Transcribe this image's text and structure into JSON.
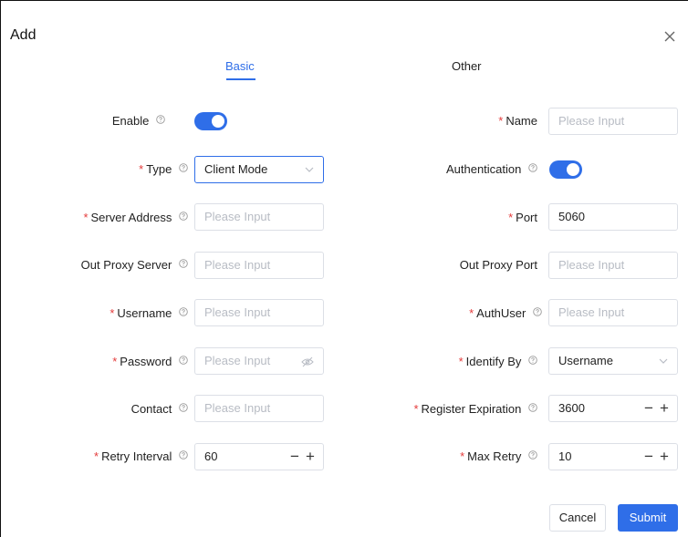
{
  "dialog": {
    "title": "Add"
  },
  "tabs": [
    {
      "label": "Basic"
    },
    {
      "label": "Other"
    }
  ],
  "fields": {
    "enable": {
      "label": "Enable",
      "value": true
    },
    "name": {
      "label": "Name",
      "placeholder": "Please Input"
    },
    "type": {
      "label": "Type",
      "value": "Client Mode"
    },
    "authentication": {
      "label": "Authentication",
      "value": true
    },
    "server_address": {
      "label": "Server Address",
      "placeholder": "Please Input"
    },
    "port": {
      "label": "Port",
      "value": "5060"
    },
    "out_proxy_server": {
      "label": "Out Proxy Server",
      "placeholder": "Please Input"
    },
    "out_proxy_port": {
      "label": "Out Proxy Port",
      "placeholder": "Please Input"
    },
    "username": {
      "label": "Username",
      "placeholder": "Please Input"
    },
    "authuser": {
      "label": "AuthUser",
      "placeholder": "Please Input"
    },
    "password": {
      "label": "Password",
      "placeholder": "Please Input"
    },
    "identify_by": {
      "label": "Identify By",
      "value": "Username"
    },
    "contact": {
      "label": "Contact",
      "placeholder": "Please Input"
    },
    "register_expiration": {
      "label": "Register Expiration",
      "value": "3600"
    },
    "retry_interval": {
      "label": "Retry Interval",
      "value": "60"
    },
    "max_retry": {
      "label": "Max Retry",
      "value": "10"
    }
  },
  "stepper": {
    "minus": "−",
    "plus": "+"
  },
  "required_mark": "*",
  "buttons": {
    "cancel": "Cancel",
    "submit": "Submit"
  },
  "colors": {
    "accent": "#2f6ee8",
    "required": "#e43a3a"
  }
}
